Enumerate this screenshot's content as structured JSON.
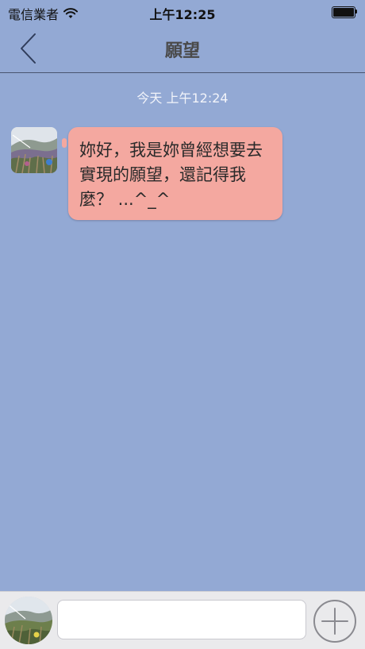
{
  "status_bar": {
    "carrier": "電信業者",
    "time": "上午12:25",
    "wifi_icon": "wifi-icon",
    "battery_icon": "battery-icon"
  },
  "nav": {
    "title": "願望",
    "back_icon": "chevron-left-icon"
  },
  "chat": {
    "timestamp": "今天 上午12:24",
    "messages": [
      {
        "sender": "other",
        "text": "妳好，我是妳曾經想要去實現的願望，還記得我麼？ ...^_^",
        "bubble_color": "#f4a8a0"
      }
    ]
  },
  "input_bar": {
    "placeholder": "",
    "value": "",
    "add_icon": "plus-circle-icon"
  },
  "colors": {
    "background": "#93a9d4",
    "bubble": "#f4a8a0",
    "input_bar": "#eaeaec"
  }
}
